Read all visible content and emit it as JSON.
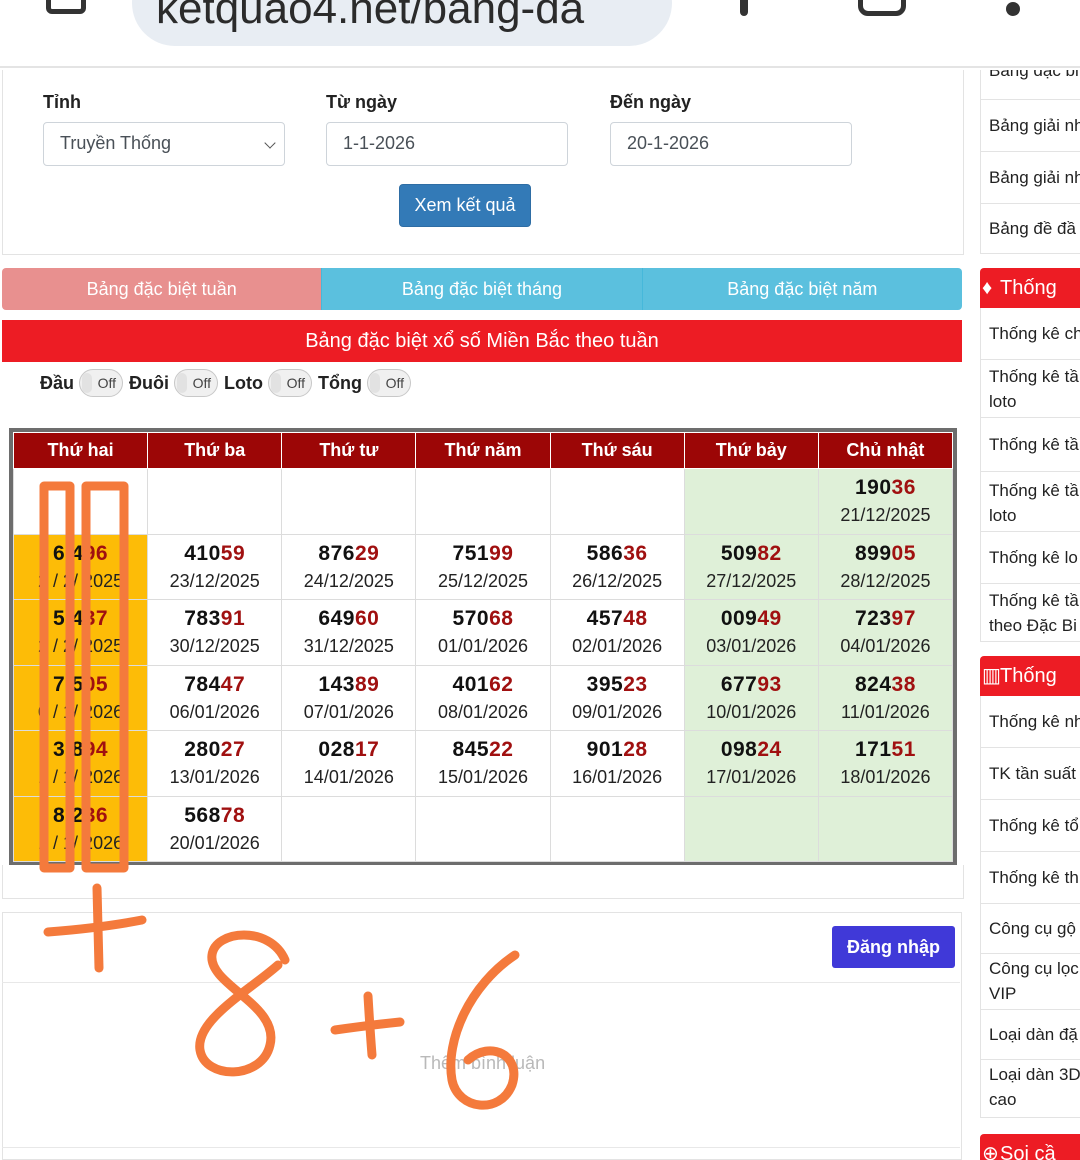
{
  "browser": {
    "url": "ketquao4.net/bang-da"
  },
  "form": {
    "province_label": "Tỉnh",
    "province_value": "Truyền Thống",
    "from_label": "Từ ngày",
    "from_value": "1-1-2026",
    "to_label": "Đến ngày",
    "to_value": "20-1-2026",
    "submit_label": "Xem kết quả"
  },
  "tabs": [
    "Bảng đặc biệt tuần",
    "Bảng đặc biệt tháng",
    "Bảng đặc biệt năm"
  ],
  "table_title": "Bảng đặc biệt xổ số Miền Bắc theo tuần",
  "toggles": [
    {
      "label": "Đầu",
      "state": "Off"
    },
    {
      "label": "Đuôi",
      "state": "Off"
    },
    {
      "label": "Loto",
      "state": "Off"
    },
    {
      "label": "Tổng",
      "state": "Off"
    }
  ],
  "days": [
    "Thứ hai",
    "Thứ ba",
    "Thứ tư",
    "Thứ năm",
    "Thứ sáu",
    "Thứ bảy",
    "Chủ nhật"
  ],
  "rows": [
    [
      null,
      null,
      null,
      null,
      null,
      null,
      {
        "head": "190",
        "tail": "36",
        "date": "21/12/2025"
      }
    ],
    [
      {
        "head": "6 4",
        "tail": "96",
        "date": "2 / 2/ 2025"
      },
      {
        "head": "410",
        "tail": "59",
        "date": "23/12/2025"
      },
      {
        "head": "876",
        "tail": "29",
        "date": "24/12/2025"
      },
      {
        "head": "751",
        "tail": "99",
        "date": "25/12/2025"
      },
      {
        "head": "586",
        "tail": "36",
        "date": "26/12/2025"
      },
      {
        "head": "509",
        "tail": "82",
        "date": "27/12/2025"
      },
      {
        "head": "899",
        "tail": "05",
        "date": "28/12/2025"
      }
    ],
    [
      {
        "head": "5 4",
        "tail": "37",
        "date": "2 / 2/ 2025"
      },
      {
        "head": "783",
        "tail": "91",
        "date": "30/12/2025"
      },
      {
        "head": "649",
        "tail": "60",
        "date": "31/12/2025"
      },
      {
        "head": "570",
        "tail": "68",
        "date": "01/01/2026"
      },
      {
        "head": "457",
        "tail": "48",
        "date": "02/01/2026"
      },
      {
        "head": "009",
        "tail": "49",
        "date": "03/01/2026"
      },
      {
        "head": "723",
        "tail": "97",
        "date": "04/01/2026"
      }
    ],
    [
      {
        "head": "7 5",
        "tail": "05",
        "date": "0 / 1/ 2026"
      },
      {
        "head": "784",
        "tail": "47",
        "date": "06/01/2026"
      },
      {
        "head": "143",
        "tail": "89",
        "date": "07/01/2026"
      },
      {
        "head": "401",
        "tail": "62",
        "date": "08/01/2026"
      },
      {
        "head": "395",
        "tail": "23",
        "date": "09/01/2026"
      },
      {
        "head": "677",
        "tail": "93",
        "date": "10/01/2026"
      },
      {
        "head": "824",
        "tail": "38",
        "date": "11/01/2026"
      }
    ],
    [
      {
        "head": "3 8",
        "tail": "94",
        "date": "1 / 1/ 2026"
      },
      {
        "head": "280",
        "tail": "27",
        "date": "13/01/2026"
      },
      {
        "head": "028",
        "tail": "17",
        "date": "14/01/2026"
      },
      {
        "head": "845",
        "tail": "22",
        "date": "15/01/2026"
      },
      {
        "head": "901",
        "tail": "28",
        "date": "16/01/2026"
      },
      {
        "head": "098",
        "tail": "24",
        "date": "17/01/2026"
      },
      {
        "head": "171",
        "tail": "51",
        "date": "18/01/2026"
      }
    ],
    [
      {
        "head": "8 2",
        "tail": "36",
        "date": "1 / 1/ 2026"
      },
      {
        "head": "568",
        "tail": "78",
        "date": "20/01/2026"
      },
      null,
      null,
      null,
      null,
      null
    ]
  ],
  "comment": {
    "login_label": "Đăng nhập",
    "placeholder": "Thêm bình luận"
  },
  "sidebar": {
    "top_items": [
      "Bảng đặc bi",
      "Bảng giải nh",
      "Bảng giải nh",
      "Bảng đề đầ"
    ],
    "section1_title": "Thống",
    "section1_items": [
      "Thống kê ch",
      "Thống kê tầ loto",
      "Thống kê tầ",
      "Thống kê tầ loto",
      "Thống kê lo",
      "Thống kê tầ theo Đặc Bi"
    ],
    "section2_title": "Thống",
    "section2_items": [
      "Thống kê nh",
      "TK tần suất",
      "Thống kê tổ",
      "Thống kê th",
      "Công cụ gộ",
      "Công cụ lọc VIP",
      "Loại dàn đặ",
      "Loại dàn 3D cao"
    ],
    "section3_title": "Soi cầ"
  },
  "annotation": {
    "handwriting": "8 + 6",
    "color": "#f47a3c"
  },
  "colors": {
    "header_red": "#9c0606",
    "monday_yellow": "#fdbc07",
    "weekend_green": "#dff0d8",
    "tab_blue": "#5bc0de",
    "tab_active": "#e8908f",
    "title_red": "#ed1c24",
    "button_blue": "#337ab7",
    "login_purple": "#4039d8"
  }
}
